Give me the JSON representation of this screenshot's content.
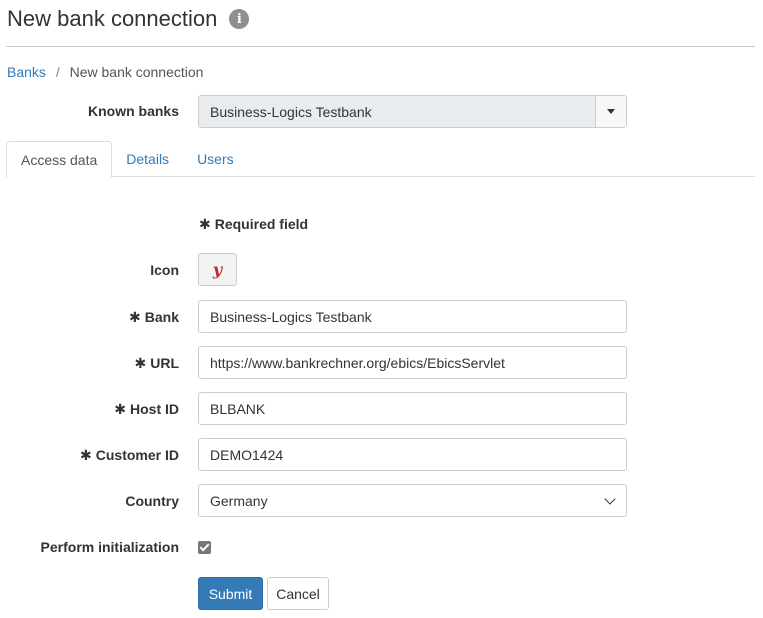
{
  "header": {
    "title": "New bank connection",
    "info_icon": "info-icon",
    "info_glyph": "i"
  },
  "breadcrumb": {
    "root": "Banks",
    "separator": "/",
    "current": "New bank connection"
  },
  "known_banks": {
    "label": "Known banks",
    "value": "Business-Logics Testbank"
  },
  "tabs": [
    {
      "label": "Access data",
      "active": true
    },
    {
      "label": "Details",
      "active": false
    },
    {
      "label": "Users",
      "active": false
    }
  ],
  "form": {
    "required_star": "✱",
    "required_note": "Required field",
    "icon": {
      "label": "Icon",
      "glyph": "y",
      "color": "#c0262d"
    },
    "bank": {
      "label": "Bank",
      "value": "Business-Logics Testbank"
    },
    "url": {
      "label": "URL",
      "value": "https://www.bankrechner.org/ebics/EbicsServlet"
    },
    "host_id": {
      "label": "Host ID",
      "value": "BLBANK"
    },
    "customer_id": {
      "label": "Customer ID",
      "value": "DEMO1424"
    },
    "country": {
      "label": "Country",
      "value": "Germany"
    },
    "perform_init": {
      "label": "Perform initialization",
      "checked": true
    }
  },
  "buttons": {
    "submit": "Submit",
    "cancel": "Cancel"
  },
  "colors": {
    "primary": "#337ab7",
    "link": "#337ab7"
  }
}
